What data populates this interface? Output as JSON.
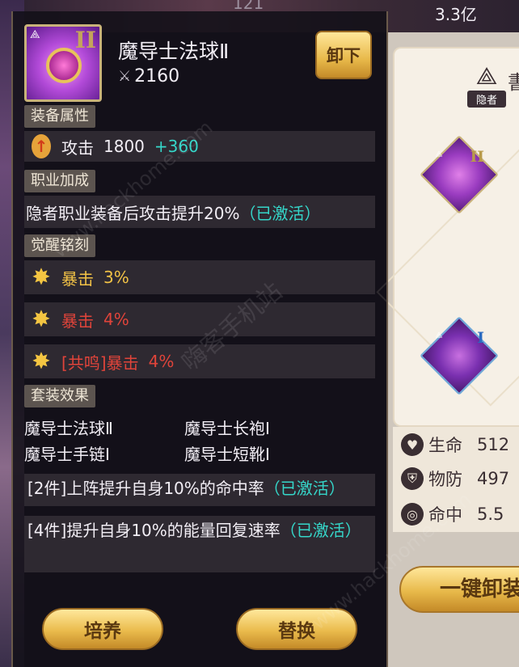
{
  "top_bar": {
    "value_faded": "121",
    "value": "3.3亿"
  },
  "item": {
    "name": "魔导士法球Ⅱ",
    "tier": "II",
    "power": "2160",
    "unequip_label": "卸下"
  },
  "sections": {
    "equip_attr": "装备属性",
    "job_bonus": "职业加成",
    "awaken": "觉醒铭刻",
    "set_effect": "套装效果"
  },
  "attack": {
    "label": "攻击",
    "base": "1800",
    "bonus": "+360"
  },
  "job_bonus_text": {
    "desc": "隐者职业装备后攻击提升20%",
    "status": "（已激活）"
  },
  "awaken_rows": [
    {
      "text": "暴击",
      "value": "3%",
      "color": "#f2c246"
    },
    {
      "text": "暴击",
      "value": "4%",
      "color": "#e0443a"
    },
    {
      "text": "[共鸣]暴击",
      "value": "4%",
      "color": "#e0443a"
    }
  ],
  "set_items": [
    "魔导士法球Ⅱ",
    "魔导士长袍Ⅰ",
    "魔导士手链Ⅰ",
    "魔导士短靴Ⅰ"
  ],
  "set_bonuses": [
    {
      "text": "[2件]上阵提升自身10%的命中率",
      "status": "（已激活）"
    },
    {
      "text": "[4件]提升自身10%的能量回复速率",
      "status": "（已激活）"
    }
  ],
  "buttons": {
    "train": "培养",
    "replace": "替换"
  },
  "right_panel": {
    "class_label": "隐者",
    "title_partial": "書",
    "slot1_tier": "II",
    "slot2_tier": "I",
    "stats": [
      {
        "label": "生命",
        "value": "512",
        "icon": "heart-icon"
      },
      {
        "label": "物防",
        "value": "497",
        "icon": "shield-icon"
      },
      {
        "label": "命中",
        "value": "5.5",
        "icon": "target-icon"
      }
    ],
    "unequip_all": "一键卸装"
  },
  "watermarks": [
    "嗨客手机站",
    "www.hackhome.com"
  ]
}
